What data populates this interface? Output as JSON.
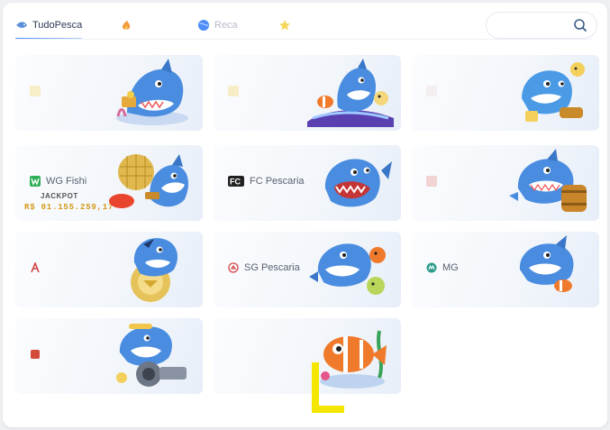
{
  "tabs": [
    {
      "label": "TudoPesca",
      "icon": "fish-icon",
      "active": true
    },
    {
      "label": "",
      "icon": "fire-icon",
      "active": false
    },
    {
      "label": "Reca",
      "icon": "globe-icon",
      "active": false
    },
    {
      "label": "",
      "icon": "star-icon",
      "active": false
    }
  ],
  "search": {
    "placeholder": ""
  },
  "cards": [
    {
      "title": "",
      "logo": "provider-logo",
      "art": "shark-treasure-icon"
    },
    {
      "title": "",
      "logo": "provider-logo",
      "art": "shark-surf-icon"
    },
    {
      "title": "",
      "logo": "provider-logo",
      "art": "shark-pufferfish-icon"
    },
    {
      "title": "WG Fishi",
      "logo": "wg-logo-icon",
      "art": "shark-disco-icon",
      "jackpot_label": "JACKPOT",
      "jackpot_amount": "R$ 01.155.259,17"
    },
    {
      "title": "FC Pescaria",
      "logo": "fc-logo-icon",
      "art": "shark-jaws-icon"
    },
    {
      "title": "",
      "logo": "provider-logo",
      "art": "shark-barrel-icon"
    },
    {
      "title": "",
      "logo": "provider-logo",
      "art": "shark-chip-icon"
    },
    {
      "title": "SG Pescaria",
      "logo": "sg-logo-icon",
      "art": "shark-pufferfish-icon"
    },
    {
      "title": "MG",
      "logo": "mg-logo-icon",
      "art": "shark-fish-icon"
    },
    {
      "title": "",
      "logo": "provider-logo",
      "art": "shark-cannon-icon"
    },
    {
      "title": "",
      "logo": "provider-logo",
      "art": "clownfish-icon"
    }
  ],
  "colors": {
    "accent": "#4d8df7",
    "jackpot": "#d59a1a",
    "overlay_mark": "#f5e600"
  }
}
